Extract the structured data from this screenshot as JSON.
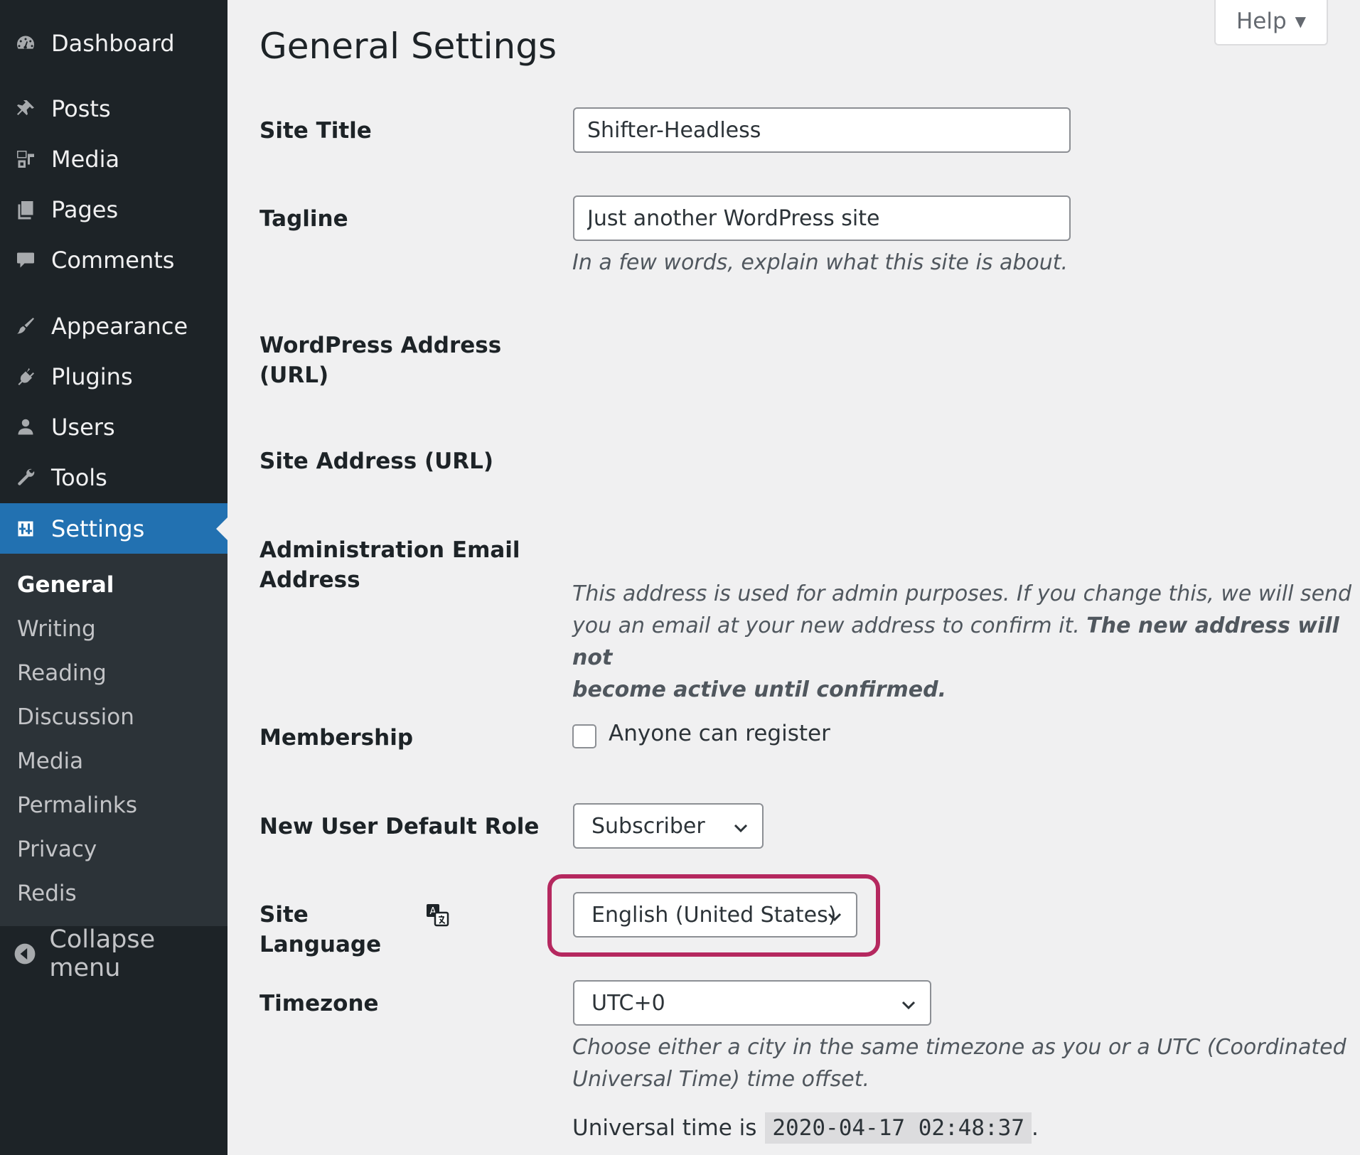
{
  "sidebar": {
    "items": [
      {
        "label": "Dashboard",
        "icon": "dashboard-icon"
      },
      {
        "label": "Posts",
        "icon": "pin-icon"
      },
      {
        "label": "Media",
        "icon": "media-icon"
      },
      {
        "label": "Pages",
        "icon": "pages-icon"
      },
      {
        "label": "Comments",
        "icon": "comment-icon"
      },
      {
        "label": "Appearance",
        "icon": "paintbrush-icon"
      },
      {
        "label": "Plugins",
        "icon": "plugin-icon"
      },
      {
        "label": "Users",
        "icon": "user-icon"
      },
      {
        "label": "Tools",
        "icon": "wrench-icon"
      },
      {
        "label": "Settings",
        "icon": "settings-icon"
      }
    ],
    "submenu": [
      "General",
      "Writing",
      "Reading",
      "Discussion",
      "Media",
      "Permalinks",
      "Privacy",
      "Redis"
    ],
    "collapse_label": "Collapse menu",
    "active_color": "#2271b1"
  },
  "help_label": "Help",
  "page_title": "General Settings",
  "fields": {
    "site_title": {
      "label": "Site Title",
      "value": "Shifter-Headless"
    },
    "tagline": {
      "label": "Tagline",
      "value": "Just another WordPress site",
      "description": "In a few words, explain what this site is about."
    },
    "wp_address": {
      "label_line1": "WordPress Address",
      "label_line2": "(URL)"
    },
    "site_address": {
      "label": "Site Address (URL)"
    },
    "admin_email": {
      "label_line1": "Administration Email",
      "label_line2": "Address",
      "description_line1": "This address is used for admin purposes. If you change this, we will send",
      "description_line2_a": "you an email at your new address to confirm it. ",
      "description_line2_b": "The new address will not",
      "description_line3": "become active until confirmed."
    },
    "membership": {
      "label": "Membership",
      "checkbox_label": "Anyone can register",
      "checked": false
    },
    "default_role": {
      "label": "New User Default Role",
      "value": "Subscriber"
    },
    "site_language": {
      "label": "Site Language",
      "value": "English (United States)",
      "highlight_color": "#b5285f"
    },
    "timezone": {
      "label": "Timezone",
      "value": "UTC+0",
      "description_line1": "Choose either a city in the same timezone as you or a UTC (Coordinated",
      "description_line2": "Universal Time) time offset.",
      "universal_prefix": "Universal time is",
      "universal_value": "2020-04-17 02:48:37",
      "universal_suffix": "."
    }
  }
}
